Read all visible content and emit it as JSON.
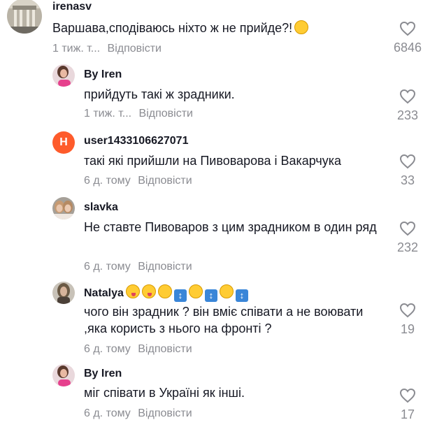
{
  "comments": [
    {
      "author": "irenasv",
      "text": "Варшава,сподіваюсь ніхто ж не прийде?!",
      "time": "1 тиж. т...",
      "reply": "Відповісти",
      "likes": "6846",
      "emojis": [
        "smirk-emoji"
      ]
    },
    {
      "author": "By Iren",
      "text": "прийдуть такі ж зрадники.",
      "time": "1 тиж. т...",
      "reply": "Відповісти",
      "likes": "233"
    },
    {
      "author": "user1433106627071",
      "avatar_letter": "H",
      "text": "такі які прийшли на Пивоварова і Вакарчука",
      "time": "6 д. тому",
      "reply": "Відповісти",
      "likes": "33"
    },
    {
      "author": "slavka",
      "text": "Не ставте Пивоваров з цим зрадником в один ряд",
      "time": "6 д. тому",
      "reply": "Відповісти",
      "likes": "232"
    },
    {
      "author": "Natalya",
      "author_emojis": [
        "tongue-emoji",
        "tongue-emoji",
        "smile-emoji",
        "up-down-arrow-emoji",
        "smile-emoji",
        "up-down-arrow-emoji",
        "smile-emoji",
        "up-down-arrow-emoji"
      ],
      "text": "чого він зрадник ? він вміє співати а не воювати ,яка користь з нього на фронті ?",
      "time": "6 д. тому",
      "reply": "Відповісти",
      "likes": "19"
    },
    {
      "author": "By Iren",
      "text": "міг співати в Україні як інші.",
      "time": "6 д. тому",
      "reply": "Відповісти",
      "likes": "17"
    }
  ],
  "colors": {
    "text": "#161823",
    "muted": "#8a8b91",
    "avatar_h": "#fe5b2b"
  }
}
